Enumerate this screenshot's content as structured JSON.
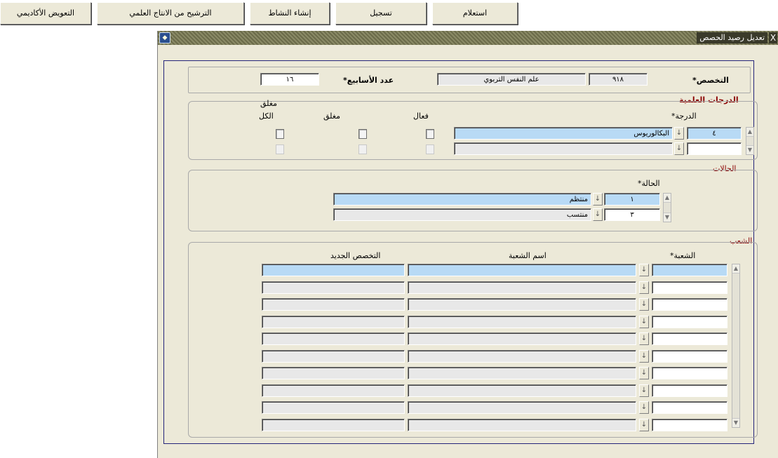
{
  "toolbar": {
    "btn_delegation": "التعويض الأكاديمي",
    "btn_promotion": "الترشيح من الانتاج العلمي",
    "btn_activity": "إنشاء النشاط",
    "btn_save": "تسجيل",
    "btn_query": "استعلام"
  },
  "window": {
    "title": "تعديل رصيد الحصص",
    "close_glyph": "X"
  },
  "header": {
    "specialty_label": "التخصص*",
    "specialty_code": "٩١٨",
    "specialty_name": "علم النفس التربوي",
    "weeks_label": "عدد الأسابيع*",
    "weeks_value": "١٦"
  },
  "degrees": {
    "section_title": "الدرجات العلمية",
    "degree_label": "الدرجة*",
    "active_label": "فعال",
    "closed_group_label": "مغلق",
    "closed_col_label": "مغلق",
    "all_col_label": "الكل",
    "rows": [
      {
        "code": "٤",
        "name": "البكالوريوس"
      },
      {
        "code": "",
        "name": ""
      }
    ]
  },
  "status": {
    "section_title": "الحالات",
    "status_label": "الحالة*",
    "rows": [
      {
        "code": "١",
        "name": "منتظم"
      },
      {
        "code": "٣",
        "name": "منتسب"
      }
    ]
  },
  "groups": {
    "section_title": "الشعب",
    "col_group": "الشعبة*",
    "col_name": "اسم الشعبة",
    "col_specialty": "التخصص الجديد",
    "rows": [
      {
        "code": "",
        "name": "",
        "specialty": ""
      },
      {
        "code": "",
        "name": "",
        "specialty": ""
      },
      {
        "code": "",
        "name": "",
        "specialty": ""
      },
      {
        "code": "",
        "name": "",
        "specialty": ""
      },
      {
        "code": "",
        "name": "",
        "specialty": ""
      },
      {
        "code": "",
        "name": "",
        "specialty": ""
      },
      {
        "code": "",
        "name": "",
        "specialty": ""
      },
      {
        "code": "",
        "name": "",
        "specialty": ""
      },
      {
        "code": "",
        "name": "",
        "specialty": ""
      },
      {
        "code": "",
        "name": "",
        "specialty": ""
      }
    ]
  },
  "icons": {
    "lov": "↓",
    "scroll_up": "▲",
    "scroll_down": "▼"
  }
}
